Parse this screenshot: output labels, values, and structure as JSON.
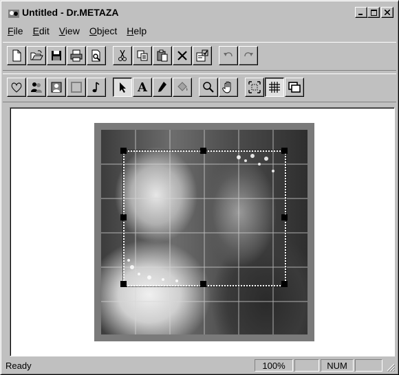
{
  "window": {
    "title": "Untitled - Dr.METAZA"
  },
  "menu": [
    {
      "ul": "F",
      "rest": "ile"
    },
    {
      "ul": "E",
      "rest": "dit"
    },
    {
      "ul": "V",
      "rest": "iew"
    },
    {
      "ul": "O",
      "rest": "bject"
    },
    {
      "ul": "H",
      "rest": "elp"
    }
  ],
  "toolbar1": [
    "new-file-icon",
    "open-folder-icon",
    "save-disk-icon",
    "print-icon",
    "print-preview-icon",
    "cut-scissors-icon",
    "copy-icon",
    "paste-icon",
    "delete-x-icon",
    "properties-icon",
    "undo-icon",
    "redo-icon"
  ],
  "toolbar2": [
    "heart-icon",
    "people-icon",
    "portrait-icon",
    "frame-icon",
    "music-note-icon",
    "arrow-pointer-icon",
    "text-tool-icon",
    "pen-icon",
    "fill-icon",
    "zoom-magnifier-icon",
    "hand-pan-icon",
    "fit-selection-icon",
    "grid-icon",
    "layers-icon"
  ],
  "text_tool_label": "A",
  "status": {
    "text": "Ready",
    "zoom": "100%",
    "num": "NUM"
  }
}
